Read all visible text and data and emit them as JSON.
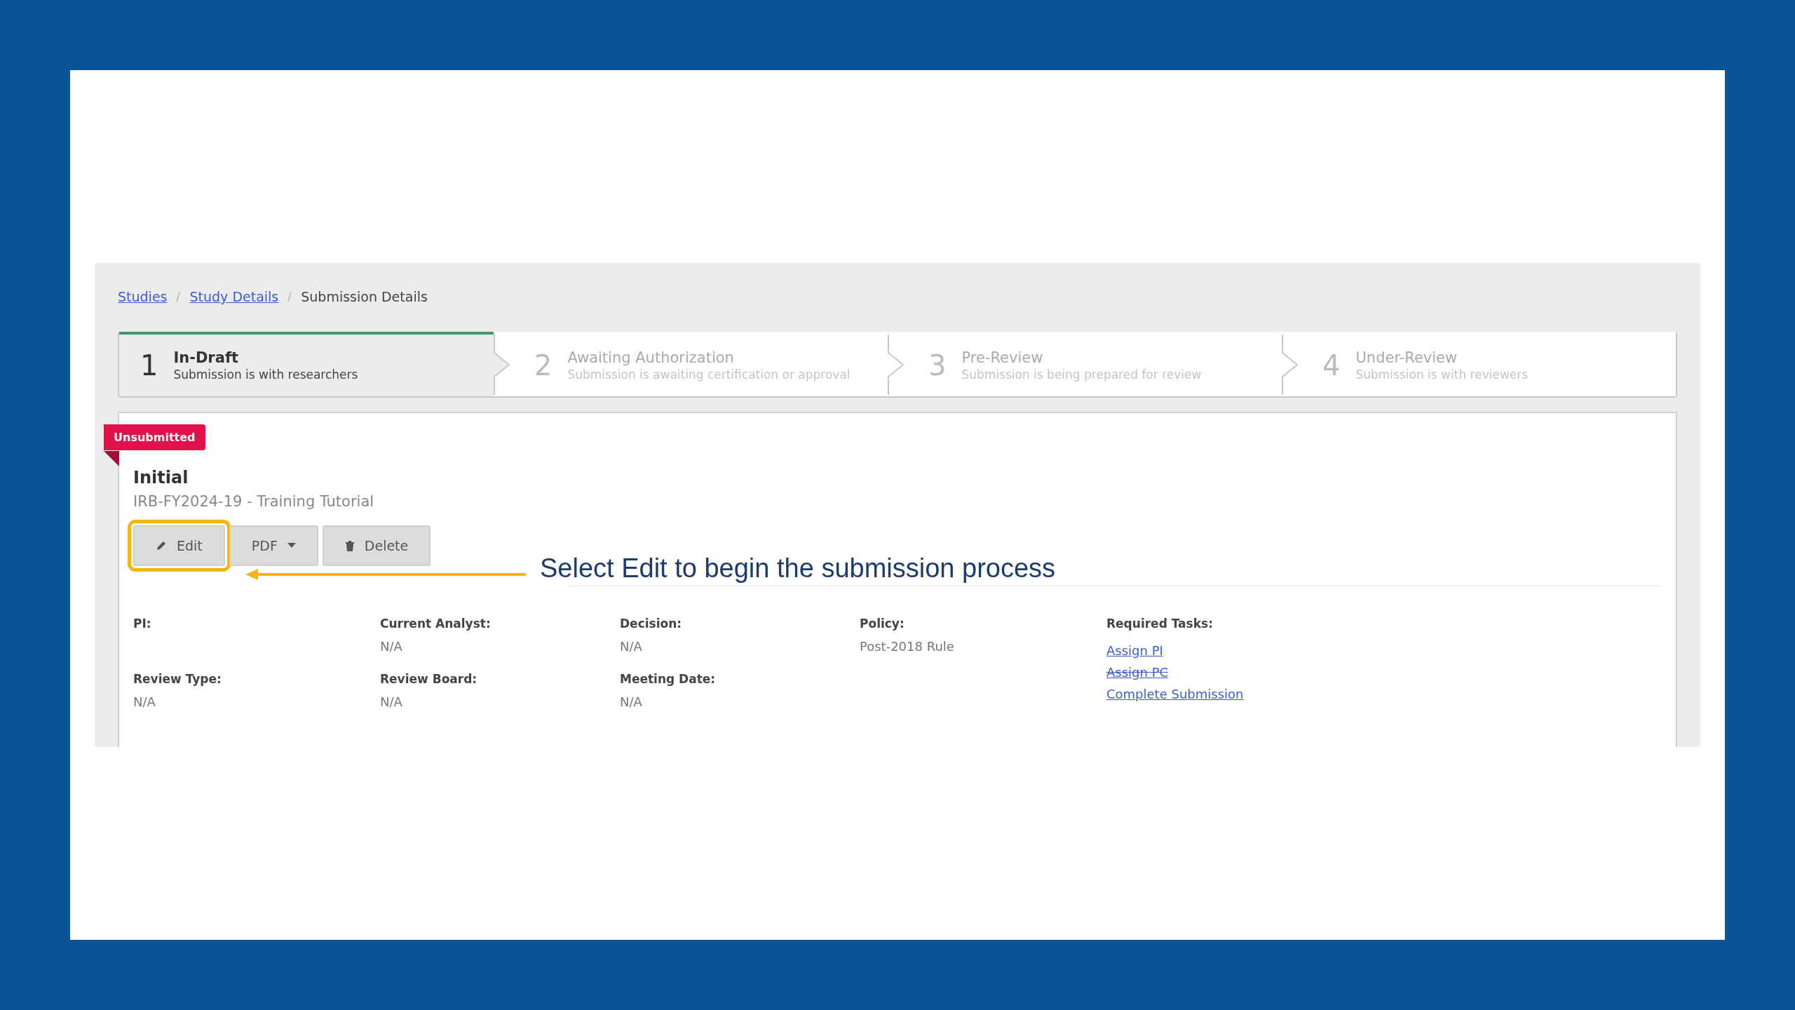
{
  "breadcrumb": [
    {
      "label": "Studies",
      "link": true
    },
    {
      "label": "Study Details",
      "link": true
    },
    {
      "label": "Submission Details",
      "link": false
    }
  ],
  "steps": [
    {
      "number": "1",
      "title": "In-Draft",
      "subtitle": "Submission is with researchers",
      "selected": true
    },
    {
      "number": "2",
      "title": "Awaiting Authorization",
      "subtitle": "Submission is awaiting certification or approval",
      "selected": false
    },
    {
      "number": "3",
      "title": "Pre-Review",
      "subtitle": "Submission is being prepared for review",
      "selected": false
    },
    {
      "number": "4",
      "title": "Under-Review",
      "subtitle": "Submission is with reviewers",
      "selected": false
    }
  ],
  "submission": {
    "status": "Unsubmitted",
    "title": "Initial",
    "study": "IRB-FY2024-19 - Training Tutorial",
    "buttons": [
      {
        "kind": "edit",
        "label": "Edit",
        "highlighted": true
      },
      {
        "kind": "dropdown",
        "label": "PDF",
        "highlighted": false
      },
      {
        "kind": "delete",
        "label": "Delete",
        "highlighted": false
      }
    ]
  },
  "callout": "Select Edit to begin the submission process",
  "fields": [
    {
      "label": "PI:"
    },
    {
      "label": "Current Analyst:",
      "value": "N/A"
    },
    {
      "label": "Decision:",
      "value": "N/A"
    },
    {
      "label": "Policy:",
      "value": "Post-2018 Rule"
    },
    {
      "label": "Review Type:",
      "value": "N/A"
    },
    {
      "label": "Review Board:",
      "value": "N/A"
    },
    {
      "label": "Meeting Date:",
      "value": "N/A"
    }
  ],
  "required_tasks": {
    "label": "Required Tasks:",
    "tasks": [
      {
        "label": "Assign PI",
        "done": false
      },
      {
        "label": "Assign PC",
        "done": true
      },
      {
        "label": "Complete Submission",
        "done": false
      }
    ]
  }
}
